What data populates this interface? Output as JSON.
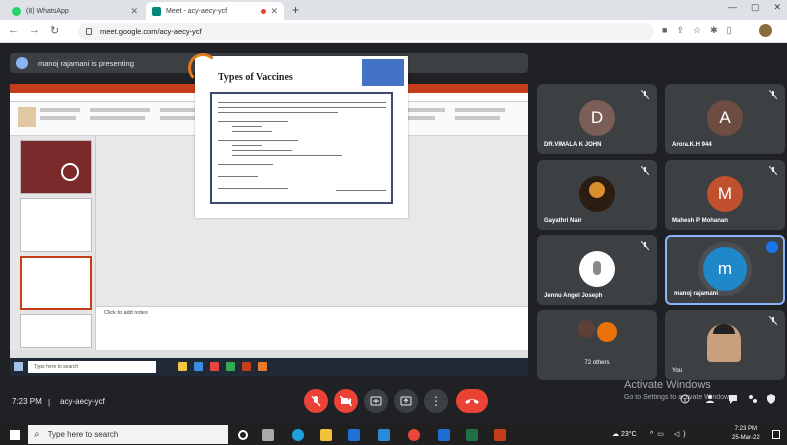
{
  "browser": {
    "tabs": [
      {
        "title": "(8) WhatsApp",
        "active": false
      },
      {
        "title": "Meet - acy-aecy-ycf",
        "active": true
      }
    ],
    "url": "meet.google.com/acy-aecy-ycf"
  },
  "meet": {
    "presenting_text": "manoj rajamani is presenting",
    "time": "7:23 PM",
    "separator": "|",
    "meeting_code": "acy-aecy-ycf",
    "participants": [
      {
        "name": "DR.VIMALA K JOHN",
        "initial": "D",
        "color": "#7b5e57"
      },
      {
        "name": "Arora.K.H 944",
        "initial": "A",
        "color": "#6d4c41"
      },
      {
        "name": "Gayathri Nair",
        "initial": "",
        "color": "#2b1d12"
      },
      {
        "name": "Mahesh P Mohanan",
        "initial": "M",
        "color": "#c1502e"
      },
      {
        "name": "Jennu Angel Joseph",
        "initial": "",
        "color": "#ffffff"
      },
      {
        "name": "manoj rajamani",
        "initial": "m",
        "color": "#1e88c8"
      },
      {
        "name": "72 others",
        "initial": "",
        "color": "#3c4043"
      },
      {
        "name": "You",
        "initial": "",
        "color": "#c9a07e"
      }
    ]
  },
  "slide": {
    "title": "Types of Vaccines",
    "notes_placeholder": "Click to add notes"
  },
  "taskbar": {
    "search_placeholder": "Type here to search",
    "weather": "23°C",
    "clock_time": "7:23 PM",
    "clock_date": "25-Mar-22"
  },
  "overlay": {
    "activate_title": "Activate Windows",
    "activate_sub": "Go to Settings to activate Windows."
  },
  "colors": {
    "accent": "#8ab4f8",
    "end_call": "#ea4335",
    "meet_bg": "#202124"
  }
}
